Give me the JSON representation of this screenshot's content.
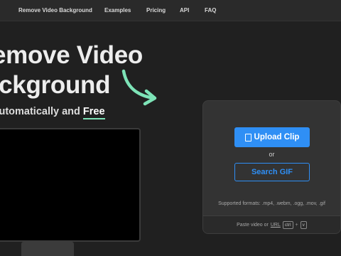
{
  "nav": {
    "links": [
      "Remove Video Background",
      "Examples",
      "Pricing",
      "API",
      "FAQ"
    ]
  },
  "hero": {
    "line1": "Remove Video",
    "line2": "Background",
    "subtitle_prefix": "Automatically and ",
    "subtitle_highlight": "Free"
  },
  "upload": {
    "upload_label": "Upload Clip",
    "or_label": "or",
    "search_label": "Search GIF",
    "formats_text": "Supported formats: .mp4, .webm, .ogg, .mov, .gif",
    "paste_prefix": "Paste video or",
    "paste_url": "URL",
    "key_ctrl": "ctrl",
    "key_plus": "+",
    "key_v": "v"
  },
  "colors": {
    "accent_blue": "#2f8ff5",
    "accent_green": "#7de3b7",
    "background": "#202020"
  },
  "icons": {
    "upload": "file-icon",
    "arrow": "curved-arrow-icon"
  }
}
